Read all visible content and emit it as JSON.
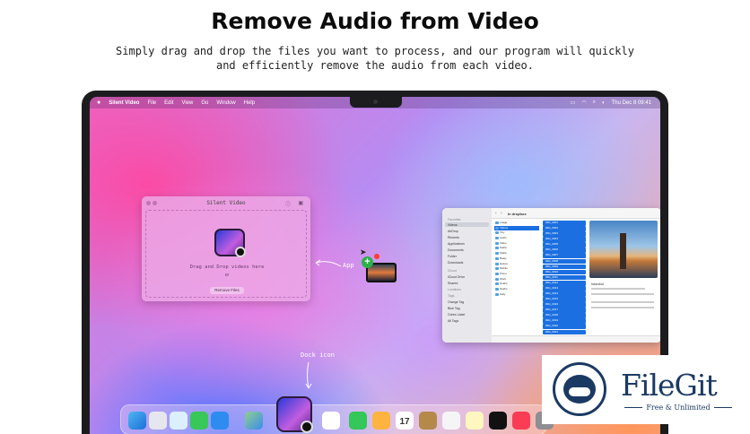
{
  "headline": "Remove Audio from Video",
  "subline": [
    "Simply drag and drop the files you want to process, and our program will quickly",
    "and efficiently remove the audio from each video."
  ],
  "menubar": {
    "apple": "",
    "app_name": "Silent Video",
    "items": [
      "File",
      "Edit",
      "View",
      "Go",
      "Window",
      "Help"
    ],
    "clock": "Thu Dec 8  09:41"
  },
  "app_window": {
    "title": "Silent Video",
    "drop_text": "Drag and Drop videos here",
    "or": "or",
    "button": "Remove Files"
  },
  "annotations": {
    "app": "App",
    "dock_icon": "Dock icon"
  },
  "finder": {
    "path": "In dropbox",
    "sidebar": [
      "Favorites",
      "Videos",
      "AirDrop",
      "Recents",
      "Applications",
      "Documents",
      "Folder",
      "Downloads",
      "iCloud",
      "iCloud Drive",
      "Shared",
      "Locations",
      "Tags",
      "Orange Tag",
      "Blue Tag",
      "Green Label",
      "All Tags"
    ],
    "col1": [
      "Image",
      "Videos",
      "Tiny",
      "Audio",
      "Video",
      "Stella",
      "Stella",
      "Beaty",
      "Nature",
      "Mobile",
      "Prime",
      "Work",
      "Studio",
      "Studio",
      "Kelly"
    ],
    "col2": [
      "IMG_0001",
      "IMG_0002",
      "IMG_0003",
      "IMG_0004",
      "IMG_0005",
      "IMG_0006",
      "IMG_0007",
      "IMG_0008",
      "IMG_0009",
      "IMG_0010",
      "IMG_0011",
      "IMG_0012",
      "IMG_0013",
      "IMG_0014",
      "IMG_0015",
      "IMG_0016",
      "IMG_0017",
      "IMG_0018",
      "IMG_0019",
      "IMG_0020",
      "IMG_0021",
      "IMG_0022",
      "IMG_0023",
      "IMG_0024",
      "IMG_0025"
    ],
    "info_title": "Istanbul"
  },
  "dock": {
    "calendar_day": "17"
  },
  "filegit": {
    "name": "FileGit",
    "tagline": "Free & Unlimited"
  },
  "colors": {
    "accent": "#1b6fe0",
    "filegit": "#1b3a63"
  }
}
